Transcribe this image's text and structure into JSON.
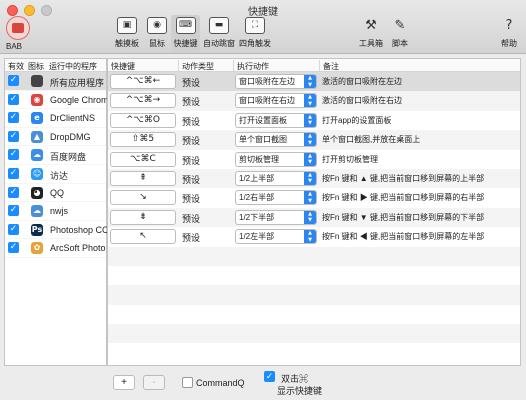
{
  "window": {
    "title": "快捷键"
  },
  "app": {
    "name": "BAB"
  },
  "toolbar": {
    "items": [
      {
        "label": "触摸板",
        "glyph": "▣"
      },
      {
        "label": "鼠标",
        "glyph": "◉"
      },
      {
        "label": "快捷键",
        "glyph": "⌨",
        "active": true
      },
      {
        "label": "自动跳窗",
        "glyph": "▬"
      },
      {
        "label": "四角触发",
        "glyph": "⛶"
      },
      {
        "label": "工具箱",
        "glyph": "⚒"
      },
      {
        "label": "脚本",
        "glyph": "✎"
      },
      {
        "label": "帮助",
        "glyph": "?"
      }
    ]
  },
  "apps": {
    "headers": {
      "enabled": "有效",
      "icon": "图标",
      "running": "运行中的程序"
    },
    "items": [
      {
        "name": "所有应用程序",
        "icon": "apple-icon",
        "glyph": "",
        "color": "#444444",
        "checked": true
      },
      {
        "name": "Google Chrome",
        "icon": "chrome-icon",
        "glyph": "◉",
        "color": "#d9463e",
        "checked": true
      },
      {
        "name": "DrClientNS",
        "icon": "drclient-icon",
        "glyph": "e",
        "color": "#2b86f0",
        "checked": true
      },
      {
        "name": "DropDMG",
        "icon": "dropdmg-icon",
        "glyph": "▲",
        "color": "#4a90d9",
        "checked": true
      },
      {
        "name": "百度网盘",
        "icon": "baidu-netdisk-icon",
        "glyph": "☁",
        "color": "#3a8ee6",
        "checked": true
      },
      {
        "name": "访达",
        "icon": "finder-icon",
        "glyph": "☺",
        "color": "#2b9af3",
        "checked": true
      },
      {
        "name": "QQ",
        "icon": "qq-icon",
        "glyph": "◕",
        "color": "#222222",
        "checked": true
      },
      {
        "name": "nwjs",
        "icon": "nwjs-icon",
        "glyph": "☁",
        "color": "#4a90d9",
        "checked": true
      },
      {
        "name": "Photoshop CC",
        "icon": "photoshop-icon",
        "glyph": "Ps",
        "color": "#0c2a4a",
        "checked": true
      },
      {
        "name": "ArcSoft Photo",
        "icon": "arcsoft-icon",
        "glyph": "✿",
        "color": "#e8a23a",
        "checked": true
      }
    ]
  },
  "shortcuts": {
    "headers": {
      "key": "快捷键",
      "type": "动作类型",
      "action": "执行动作",
      "note": "备注"
    },
    "rows": [
      {
        "key": "^⌥⌘←",
        "type": "预设",
        "action": "窗口吸附在左边",
        "note": "激活的窗口吸附在左边"
      },
      {
        "key": "^⌥⌘→",
        "type": "预设",
        "action": "窗口吸附在右边",
        "note": "激活的窗口吸附在右边"
      },
      {
        "key": "^⌥⌘O",
        "type": "预设",
        "action": "打开设置面板",
        "note": "打开app的设置面板"
      },
      {
        "key": "⇧⌘5",
        "type": "预设",
        "action": "单个窗口截图",
        "note": "单个窗口截图,并放在桌面上"
      },
      {
        "key": "⌥⌘C",
        "type": "预设",
        "action": "剪切板管理",
        "note": "打开剪切板管理"
      },
      {
        "key": "⇞",
        "type": "预设",
        "action": "1/2上半部",
        "note": "按Fn 键和 ▲ 键,把当前窗口移到屏幕的上半部"
      },
      {
        "key": "↘",
        "type": "预设",
        "action": "1/2右半部",
        "note": "按Fn 键和 ▶ 键,把当前窗口移到屏幕的右半部"
      },
      {
        "key": "⇟",
        "type": "预设",
        "action": "1/2下半部",
        "note": "按Fn 键和 ▼ 键,把当前窗口移到屏幕的下半部"
      },
      {
        "key": "↖",
        "type": "预设",
        "action": "1/2左半部",
        "note": "按Fn 键和 ◀ 键,把当前窗口移到屏幕的左半部"
      }
    ]
  },
  "bottom": {
    "add_label": "+",
    "remove_label": "-",
    "commandq_label": "CommandQ",
    "commandq_checked": false,
    "doubleclick_label": "双击⌘",
    "doubleclick_sublabel": "显示快捷键",
    "doubleclick_checked": true
  },
  "colors": {
    "accent": "#1a8cff",
    "select_arrow": "#2b86f0"
  }
}
